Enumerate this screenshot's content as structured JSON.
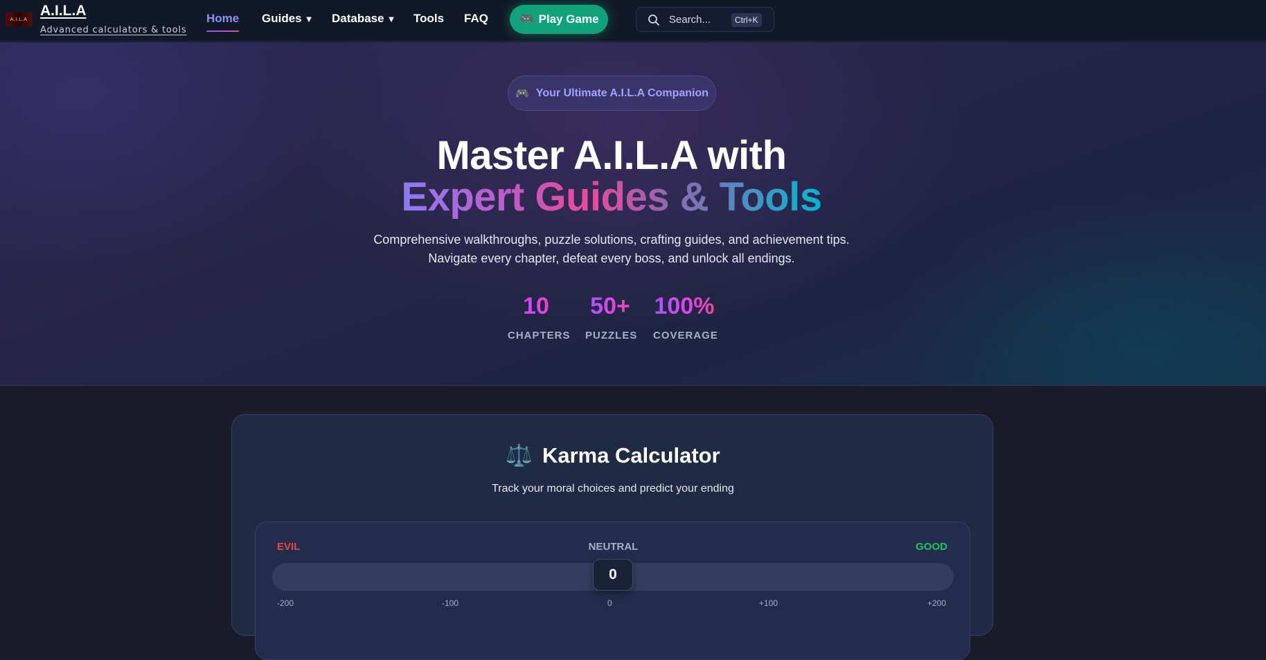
{
  "navbar": {
    "logo_text": "A.I.L.A",
    "brand_title": "A.I.L.A",
    "brand_subtitle": "Advanced calculators & tools",
    "nav_items": [
      {
        "label": "Home",
        "active": true
      },
      {
        "label": "Guides",
        "dropdown": true
      },
      {
        "label": "Database",
        "dropdown": true
      },
      {
        "label": "Tools"
      },
      {
        "label": "FAQ"
      }
    ],
    "caret": "▼",
    "play_button": {
      "icon": "🎮",
      "label": "Play Game"
    },
    "search": {
      "placeholder": "Search...",
      "shortcut": "Ctrl+K"
    }
  },
  "hero": {
    "badge": {
      "icon": "🎮",
      "text": "Your Ultimate A.I.L.A Companion"
    },
    "title_line1": "Master A.I.L.A with",
    "title_line2": "Expert Guides & Tools",
    "description_line1": "Comprehensive walkthroughs, puzzle solutions, crafting guides, and achievement tips.",
    "description_line2": "Navigate every chapter, defeat every boss, and unlock all endings.",
    "stats": [
      {
        "value": "10",
        "label": "CHAPTERS"
      },
      {
        "value": "50+",
        "label": "PUZZLES"
      },
      {
        "value": "100%",
        "label": "COVERAGE"
      }
    ]
  },
  "karma_calculator": {
    "icon": "⚖️",
    "title": "Karma Calculator",
    "subtitle": "Track your moral choices and predict your ending",
    "labels": {
      "evil": "EVIL",
      "neutral": "NEUTRAL",
      "good": "GOOD"
    },
    "value": 0,
    "value_display": "0",
    "min": -200,
    "max": 200,
    "ticks": [
      "-200",
      "-100",
      "0",
      "+100",
      "+200"
    ]
  },
  "colors": {
    "accent": "#8b8ff8",
    "play_button": "#10a37a",
    "evil": "#ef4444",
    "good": "#22c55e"
  }
}
